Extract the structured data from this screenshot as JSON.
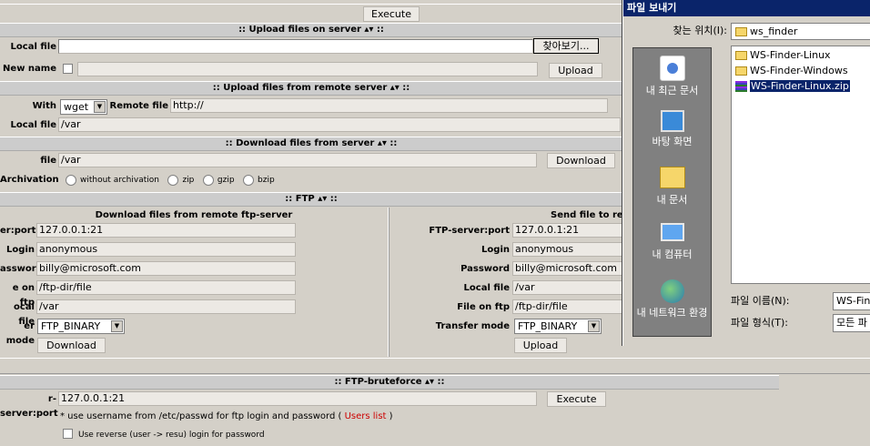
{
  "execute_top": "Execute",
  "upload_server": {
    "header": ":: Upload files on server ▴▾ ::",
    "local_file_label": "Local file",
    "browse_label": "찾아보기...",
    "new_name_label": "New name",
    "upload_label": "Upload"
  },
  "upload_remote": {
    "header": ":: Upload files from remote server ▴▾ ::",
    "with_label": "With",
    "with_value": "wget",
    "remote_file_label": "Remote file",
    "remote_file_value": "http://",
    "local_file_label": "Local file",
    "local_file_value": "/var"
  },
  "download_server": {
    "header": ":: Download files from server ▴▾ ::",
    "file_label": "file",
    "file_value": "/var",
    "download_label": "Download",
    "archivation_label": "Archivation",
    "options": [
      "without archivation",
      "zip",
      "gzip",
      "bzip"
    ]
  },
  "ftp": {
    "header": ":: FTP ▴▾ ::",
    "left": {
      "title": "Download files from remote ftp-server",
      "server_label": "er:port",
      "server_value": "127.0.0.1:21",
      "login_label": "Login",
      "login_value": "anonymous",
      "password_label": "assword",
      "password_value": "billy@microsoft.com",
      "file_on_ftp_label": "e on ftp",
      "file_on_ftp_value": "/ftp-dir/file",
      "local_file_label": "ocal file",
      "local_file_value": "/var",
      "mode_label": "er mode",
      "mode_value": "FTP_BINARY",
      "button": "Download"
    },
    "right": {
      "title": "Send file to re",
      "server_label": "FTP-server:port",
      "server_value": "127.0.0.1:21",
      "login_label": "Login",
      "login_value": "anonymous",
      "password_label": "Password",
      "password_value": "billy@microsoft.com",
      "local_file_label": "Local file",
      "local_file_value": "/var",
      "file_on_ftp_label": "File on ftp",
      "file_on_ftp_value": "/ftp-dir/file",
      "mode_label": "Transfer mode",
      "mode_value": "FTP_BINARY",
      "button": "Upload"
    }
  },
  "brute": {
    "header": ":: FTP-bruteforce ▴▾ ::",
    "server_label": "r-server:port",
    "server_value": "127.0.0.1:21",
    "execute_label": "Execute",
    "note_prefix": "* use username from /etc/passwd for ftp login and password (",
    "note_link": "Users list",
    "note_suffix": ")",
    "reverse_label": "Use reverse (user -> resu) login for password"
  },
  "colors": {
    "link": "#cc0000",
    "dialog_title": "#0a246a"
  },
  "dialog": {
    "title": "파일 보내기",
    "lookin_label": "찾는 위치(I):",
    "lookin_value": "ws_finder",
    "places": [
      "내 최근 문서",
      "바탕 화면",
      "내 문서",
      "내 컴퓨터",
      "내 네트워크 환경"
    ],
    "files": [
      "WS-Finder-Linux",
      "WS-Finder-Windows",
      "WS-Finder-Linux.zip"
    ],
    "filename_label": "파일 이름(N):",
    "filename_value": "WS-Fin",
    "filetype_label": "파일 형식(T):",
    "filetype_value": "모든 파"
  }
}
